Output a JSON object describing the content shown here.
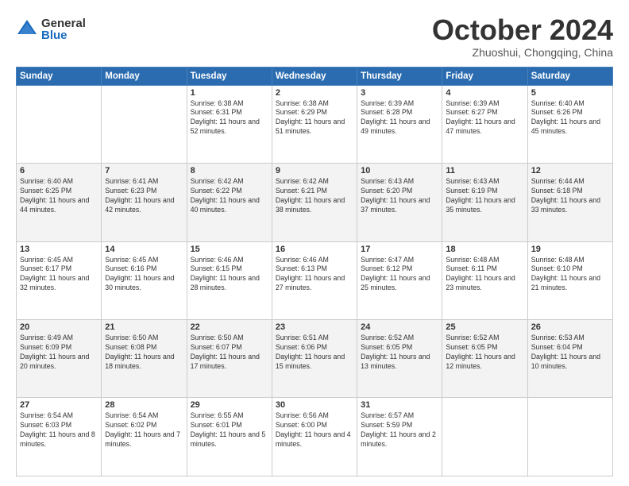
{
  "logo": {
    "general": "General",
    "blue": "Blue"
  },
  "title": "October 2024",
  "location": "Zhuoshui, Chongqing, China",
  "days_header": [
    "Sunday",
    "Monday",
    "Tuesday",
    "Wednesday",
    "Thursday",
    "Friday",
    "Saturday"
  ],
  "weeks": [
    {
      "shaded": false,
      "days": [
        {
          "num": "",
          "info": ""
        },
        {
          "num": "",
          "info": ""
        },
        {
          "num": "1",
          "info": "Sunrise: 6:38 AM\nSunset: 6:31 PM\nDaylight: 11 hours and 52 minutes."
        },
        {
          "num": "2",
          "info": "Sunrise: 6:38 AM\nSunset: 6:29 PM\nDaylight: 11 hours and 51 minutes."
        },
        {
          "num": "3",
          "info": "Sunrise: 6:39 AM\nSunset: 6:28 PM\nDaylight: 11 hours and 49 minutes."
        },
        {
          "num": "4",
          "info": "Sunrise: 6:39 AM\nSunset: 6:27 PM\nDaylight: 11 hours and 47 minutes."
        },
        {
          "num": "5",
          "info": "Sunrise: 6:40 AM\nSunset: 6:26 PM\nDaylight: 11 hours and 45 minutes."
        }
      ]
    },
    {
      "shaded": true,
      "days": [
        {
          "num": "6",
          "info": "Sunrise: 6:40 AM\nSunset: 6:25 PM\nDaylight: 11 hours and 44 minutes."
        },
        {
          "num": "7",
          "info": "Sunrise: 6:41 AM\nSunset: 6:23 PM\nDaylight: 11 hours and 42 minutes."
        },
        {
          "num": "8",
          "info": "Sunrise: 6:42 AM\nSunset: 6:22 PM\nDaylight: 11 hours and 40 minutes."
        },
        {
          "num": "9",
          "info": "Sunrise: 6:42 AM\nSunset: 6:21 PM\nDaylight: 11 hours and 38 minutes."
        },
        {
          "num": "10",
          "info": "Sunrise: 6:43 AM\nSunset: 6:20 PM\nDaylight: 11 hours and 37 minutes."
        },
        {
          "num": "11",
          "info": "Sunrise: 6:43 AM\nSunset: 6:19 PM\nDaylight: 11 hours and 35 minutes."
        },
        {
          "num": "12",
          "info": "Sunrise: 6:44 AM\nSunset: 6:18 PM\nDaylight: 11 hours and 33 minutes."
        }
      ]
    },
    {
      "shaded": false,
      "days": [
        {
          "num": "13",
          "info": "Sunrise: 6:45 AM\nSunset: 6:17 PM\nDaylight: 11 hours and 32 minutes."
        },
        {
          "num": "14",
          "info": "Sunrise: 6:45 AM\nSunset: 6:16 PM\nDaylight: 11 hours and 30 minutes."
        },
        {
          "num": "15",
          "info": "Sunrise: 6:46 AM\nSunset: 6:15 PM\nDaylight: 11 hours and 28 minutes."
        },
        {
          "num": "16",
          "info": "Sunrise: 6:46 AM\nSunset: 6:13 PM\nDaylight: 11 hours and 27 minutes."
        },
        {
          "num": "17",
          "info": "Sunrise: 6:47 AM\nSunset: 6:12 PM\nDaylight: 11 hours and 25 minutes."
        },
        {
          "num": "18",
          "info": "Sunrise: 6:48 AM\nSunset: 6:11 PM\nDaylight: 11 hours and 23 minutes."
        },
        {
          "num": "19",
          "info": "Sunrise: 6:48 AM\nSunset: 6:10 PM\nDaylight: 11 hours and 21 minutes."
        }
      ]
    },
    {
      "shaded": true,
      "days": [
        {
          "num": "20",
          "info": "Sunrise: 6:49 AM\nSunset: 6:09 PM\nDaylight: 11 hours and 20 minutes."
        },
        {
          "num": "21",
          "info": "Sunrise: 6:50 AM\nSunset: 6:08 PM\nDaylight: 11 hours and 18 minutes."
        },
        {
          "num": "22",
          "info": "Sunrise: 6:50 AM\nSunset: 6:07 PM\nDaylight: 11 hours and 17 minutes."
        },
        {
          "num": "23",
          "info": "Sunrise: 6:51 AM\nSunset: 6:06 PM\nDaylight: 11 hours and 15 minutes."
        },
        {
          "num": "24",
          "info": "Sunrise: 6:52 AM\nSunset: 6:05 PM\nDaylight: 11 hours and 13 minutes."
        },
        {
          "num": "25",
          "info": "Sunrise: 6:52 AM\nSunset: 6:05 PM\nDaylight: 11 hours and 12 minutes."
        },
        {
          "num": "26",
          "info": "Sunrise: 6:53 AM\nSunset: 6:04 PM\nDaylight: 11 hours and 10 minutes."
        }
      ]
    },
    {
      "shaded": false,
      "days": [
        {
          "num": "27",
          "info": "Sunrise: 6:54 AM\nSunset: 6:03 PM\nDaylight: 11 hours and 8 minutes."
        },
        {
          "num": "28",
          "info": "Sunrise: 6:54 AM\nSunset: 6:02 PM\nDaylight: 11 hours and 7 minutes."
        },
        {
          "num": "29",
          "info": "Sunrise: 6:55 AM\nSunset: 6:01 PM\nDaylight: 11 hours and 5 minutes."
        },
        {
          "num": "30",
          "info": "Sunrise: 6:56 AM\nSunset: 6:00 PM\nDaylight: 11 hours and 4 minutes."
        },
        {
          "num": "31",
          "info": "Sunrise: 6:57 AM\nSunset: 5:59 PM\nDaylight: 11 hours and 2 minutes."
        },
        {
          "num": "",
          "info": ""
        },
        {
          "num": "",
          "info": ""
        }
      ]
    }
  ]
}
